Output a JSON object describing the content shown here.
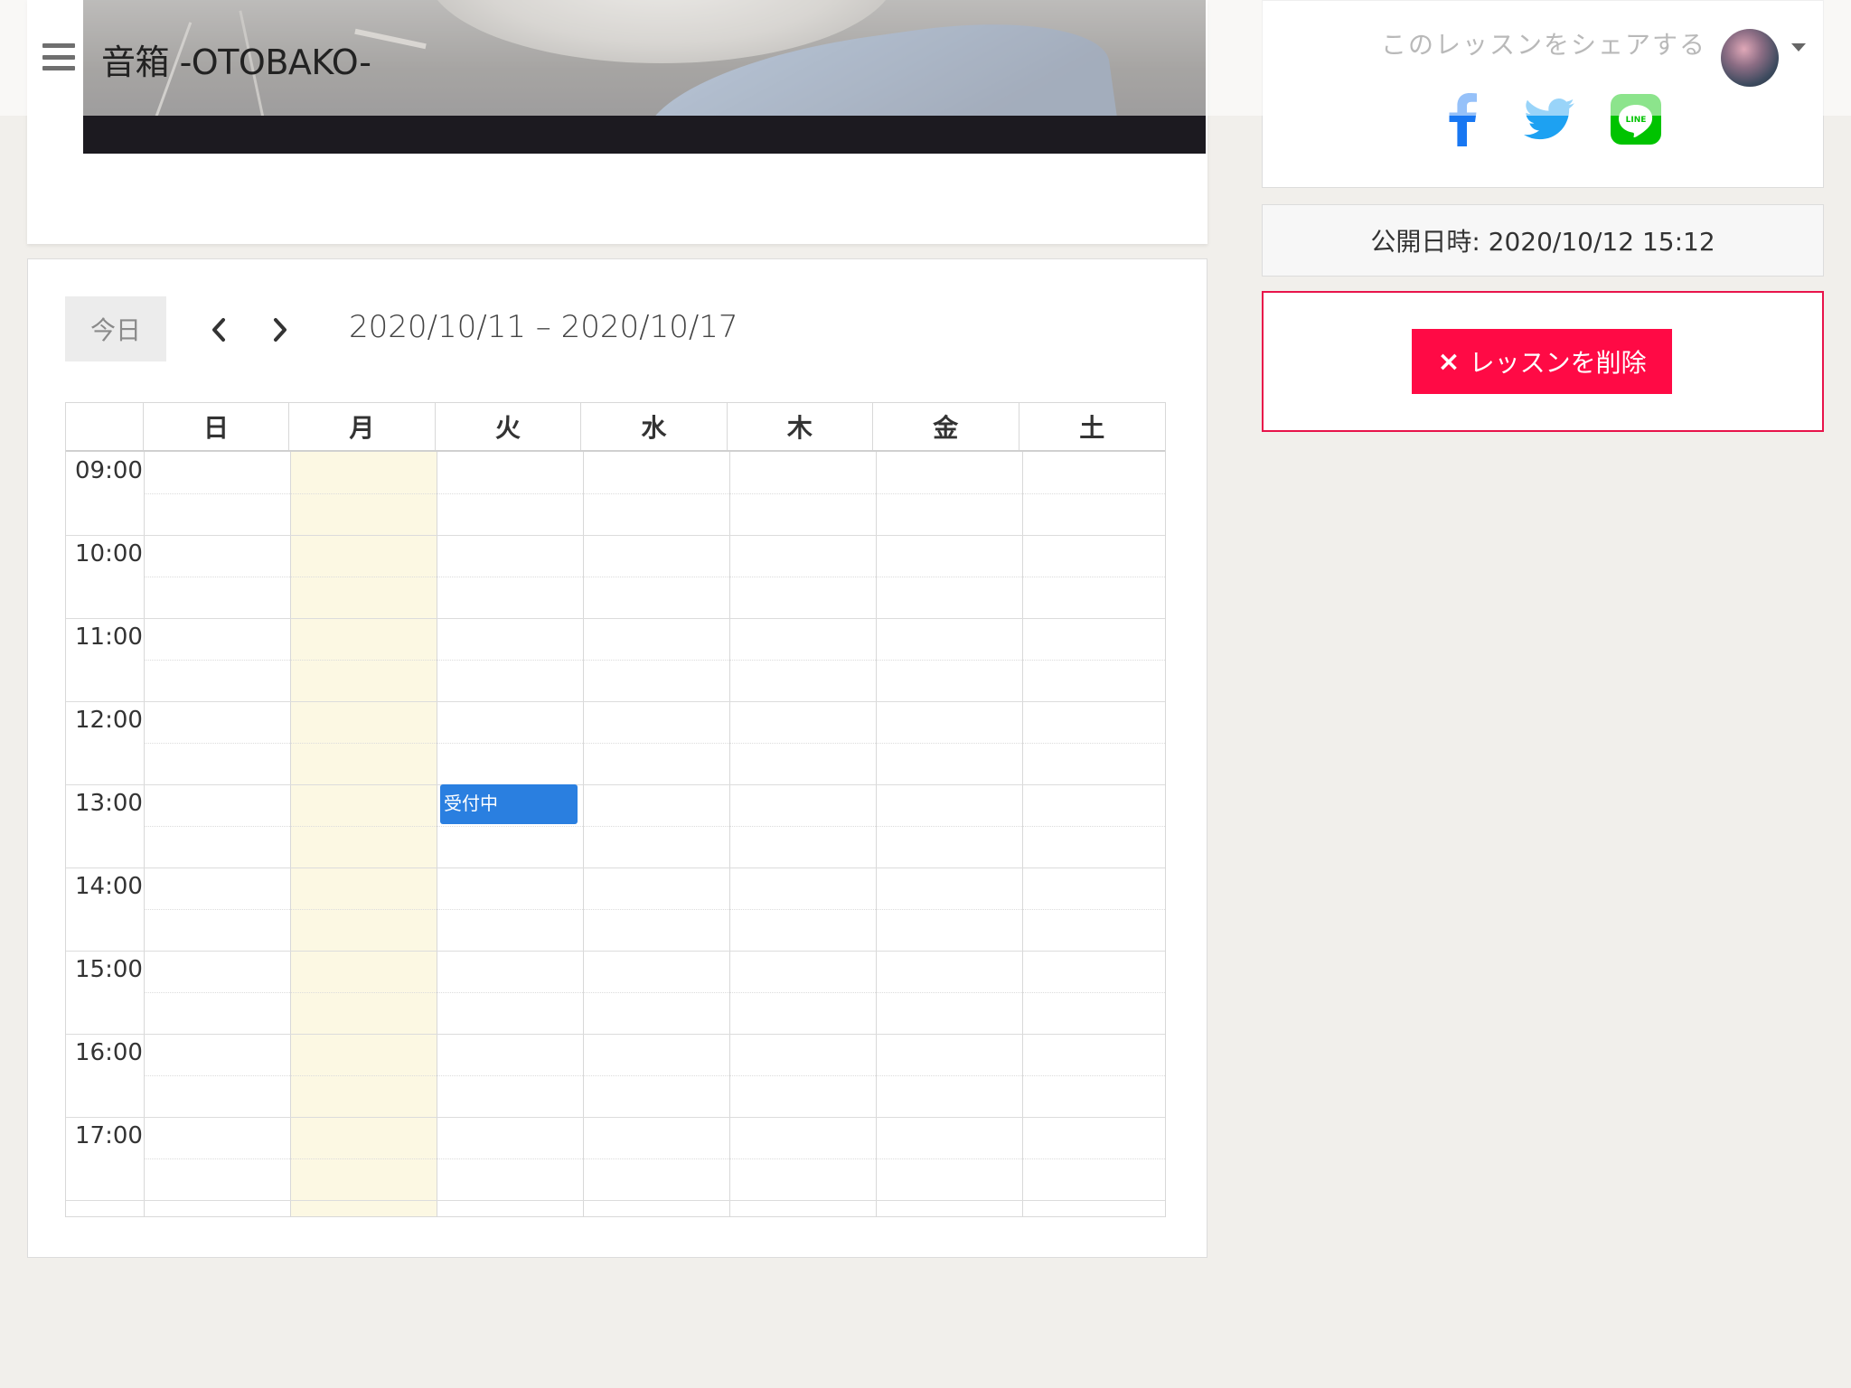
{
  "navbar": {
    "brand": "音箱 -OTOBAKO-",
    "menu_icon": "hamburger-menu-icon",
    "avatar_icon": "user-avatar"
  },
  "share": {
    "label": "このレッスンをシェアする",
    "icons": [
      "facebook-icon",
      "twitter-icon",
      "line-icon"
    ],
    "line_text": "LINE",
    "colors": {
      "facebook": "#1877f2",
      "twitter": "#1da1f2",
      "line": "#00c300"
    }
  },
  "published": {
    "text": "公開日時: 2020/10/12 15:12"
  },
  "delete": {
    "label": "レッスンを削除",
    "icon": "×",
    "color": "#ff0a45"
  },
  "calendar": {
    "today_label": "今日",
    "range": "2020/10/11 – 2020/10/17",
    "days": [
      "日",
      "月",
      "火",
      "水",
      "木",
      "金",
      "土"
    ],
    "highlighted_day": "月",
    "times": [
      "09:00",
      "10:00",
      "11:00",
      "12:00",
      "13:00",
      "14:00",
      "15:00",
      "16:00",
      "17:00"
    ],
    "event": {
      "title": "受付中",
      "day": "火",
      "time": "13:00",
      "color": "#2a7fe0"
    }
  }
}
